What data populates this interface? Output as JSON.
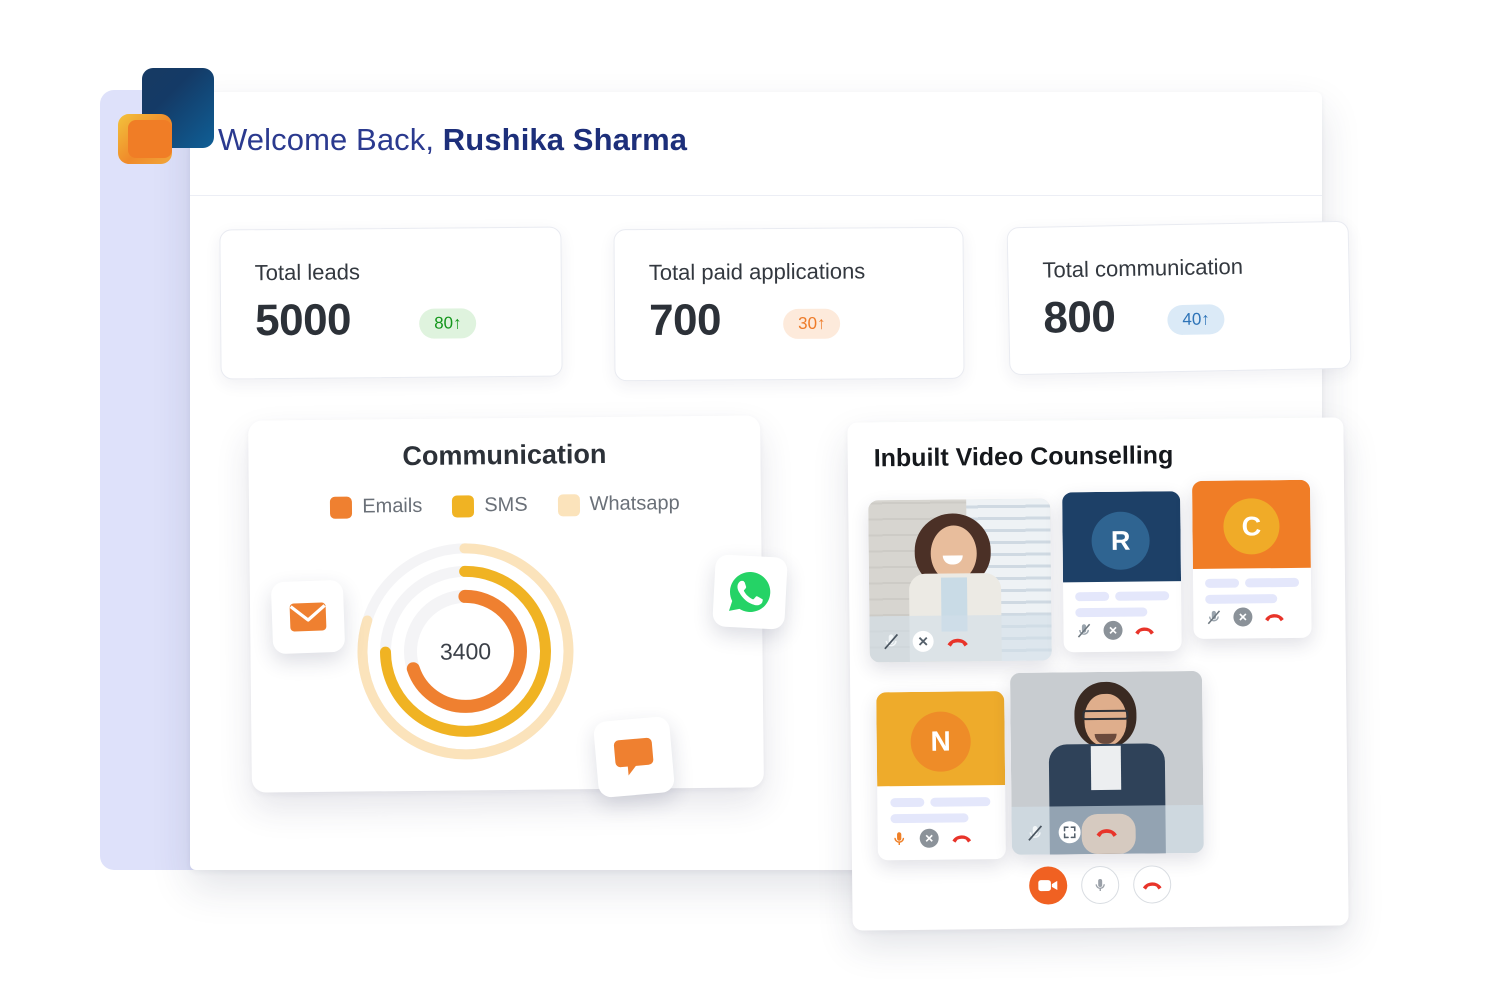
{
  "brand": {
    "logo_icon": "layered-squares-logo",
    "navy": "#15395f",
    "orange": "#f07d26",
    "yellow": "#f0b323",
    "lavender": "#dee1fa",
    "title_color": "#2b3a8f"
  },
  "header": {
    "greeting_prefix": "Welcome Back, ",
    "user_name": "Rushika Sharma"
  },
  "stats": [
    {
      "id": "total-leads",
      "title": "Total leads",
      "value": "5000",
      "badge": "80↑",
      "badge_bg": "#dff3de",
      "badge_color": "#13961b"
    },
    {
      "id": "total-paid-applications",
      "title": "Total paid applications",
      "value": "700",
      "badge": "30↑",
      "badge_bg": "#fdeadb",
      "badge_color": "#ee7b28"
    },
    {
      "id": "total-communication",
      "title": "Total communication",
      "value": "800",
      "badge": "40↑",
      "badge_bg": "#dbeaf7",
      "badge_color": "#2e74b8"
    }
  ],
  "communication": {
    "title": "Communication",
    "center_value": "3400",
    "floating_icons": [
      {
        "name": "email-icon",
        "color": "#ef8030"
      },
      {
        "name": "whatsapp-icon",
        "color": "#25d366"
      },
      {
        "name": "chat-bubble-icon",
        "color": "#ef8030"
      }
    ]
  },
  "chart_data": {
    "type": "pie",
    "title": "Communication",
    "center_label": "3400",
    "legend_position": "top",
    "grid": false,
    "categories": [
      "Emails",
      "SMS",
      "Whatsapp"
    ],
    "values": [
      70,
      75,
      80
    ],
    "unit": "percent",
    "colors": [
      "#ef8030",
      "#f0b323",
      "#fbe3bb"
    ],
    "track_color": "#f4f4f6",
    "series": [
      {
        "name": "Emails",
        "ring": "inner",
        "value": 70,
        "color": "#ef8030"
      },
      {
        "name": "SMS",
        "ring": "middle",
        "value": 75,
        "color": "#f0b323"
      },
      {
        "name": "Whatsapp",
        "ring": "outer",
        "value": 80,
        "color": "#fbe3bb"
      }
    ],
    "ylim": [
      0,
      100
    ]
  },
  "video": {
    "title": "Inbuilt Video Counselling",
    "tiles": [
      {
        "id": "tile-photo-woman",
        "kind": "photo",
        "subject": "woman-in-white-blazer",
        "controls": [
          "mic-off-icon",
          "close-icon",
          "hangup-icon"
        ]
      },
      {
        "id": "tile-r",
        "kind": "avatar",
        "initial": "R",
        "bg": "#1d4067",
        "circle": "#2f6491",
        "controls": [
          "mic-off-icon",
          "close-icon",
          "hangup-icon"
        ]
      },
      {
        "id": "tile-c",
        "kind": "avatar",
        "initial": "C",
        "bg": "#f07d26",
        "circle": "#f0ab28",
        "controls": [
          "mic-off-icon",
          "close-icon",
          "hangup-icon"
        ]
      },
      {
        "id": "tile-n",
        "kind": "avatar",
        "initial": "N",
        "bg": "#eeab2b",
        "circle": "#ee8c28",
        "controls": [
          "mic-on-icon",
          "close-icon",
          "hangup-icon"
        ]
      },
      {
        "id": "tile-photo-man",
        "kind": "photo",
        "subject": "man-in-denim-shirt",
        "controls": [
          "mic-off-icon",
          "expand-icon",
          "hangup-icon"
        ]
      }
    ],
    "toolbar": [
      {
        "name": "camera-button",
        "icon": "video-camera-icon",
        "style": "filled",
        "color": "#f06122"
      },
      {
        "name": "mic-button",
        "icon": "microphone-icon",
        "style": "outline",
        "color": "#9aa0a8"
      },
      {
        "name": "end-call-button",
        "icon": "hangup-icon",
        "style": "outline",
        "color": "#e8342a"
      }
    ]
  }
}
